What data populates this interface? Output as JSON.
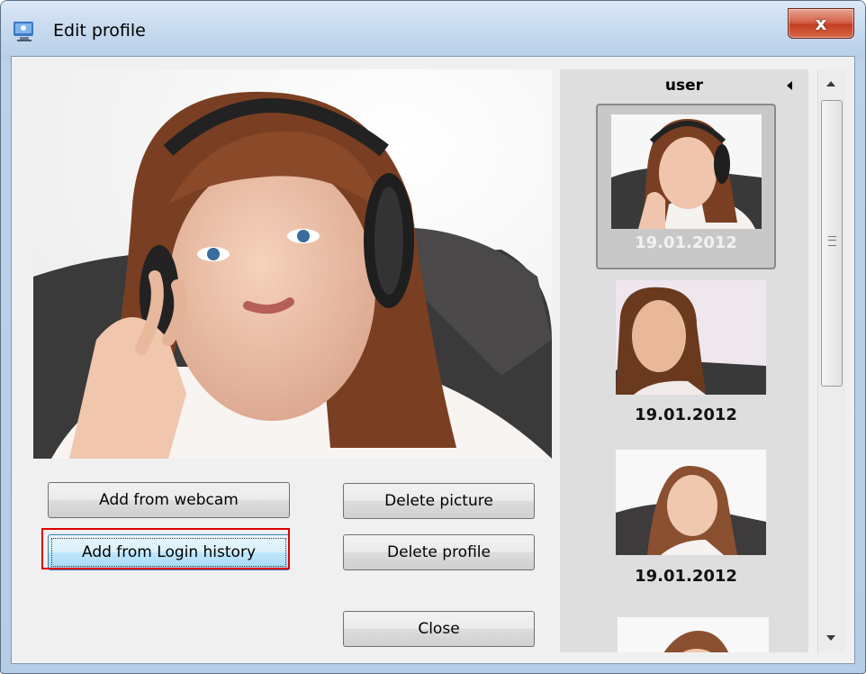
{
  "window": {
    "title": "Edit profile",
    "close_glyph": "x"
  },
  "buttons": {
    "add_webcam": "Add from webcam",
    "add_login_history": "Add from Login history",
    "delete_picture": "Delete picture",
    "delete_profile": "Delete profile",
    "close": "Close"
  },
  "list": {
    "header": "user",
    "items": [
      {
        "date": "19.01.2012",
        "selected": true
      },
      {
        "date": "19.01.2012",
        "selected": false
      },
      {
        "date": "19.01.2012",
        "selected": false
      },
      {
        "date": "",
        "selected": false
      }
    ]
  },
  "colors": {
    "highlight": "#e00000",
    "titlebar": "#c6d9ee"
  },
  "icons": [
    "app-icon",
    "close-icon",
    "sort-arrow-icon",
    "scroll-up-icon",
    "scroll-down-icon"
  ]
}
